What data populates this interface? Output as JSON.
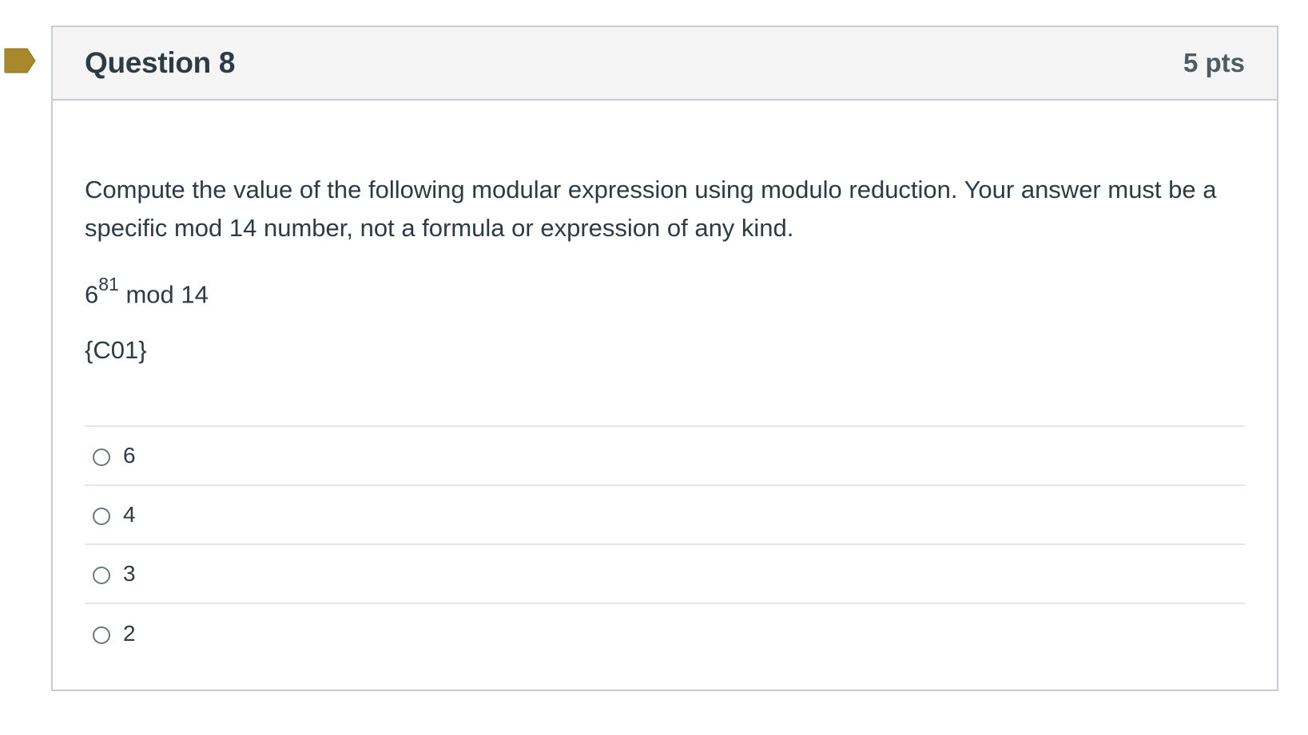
{
  "question": {
    "title": "Question 8",
    "points": "5 pts",
    "text": "Compute the value of the following modular expression using modulo reduction. Your answer must be a specific mod 14 number, not a formula or expression of any kind.",
    "expression": {
      "base": "6",
      "exponent": "81",
      "suffix": " mod 14"
    },
    "placeholder": "{C01}",
    "answers": [
      {
        "label": "6",
        "selected": false
      },
      {
        "label": "4",
        "selected": false
      },
      {
        "label": "3",
        "selected": false
      },
      {
        "label": "2",
        "selected": false
      }
    ]
  },
  "colors": {
    "bookmark": "#a8882b",
    "header_bg": "#f5f5f5",
    "border": "#c7cdd1",
    "text": "#2d3b45"
  },
  "icons": {
    "bookmark": "bookmark-flag-icon",
    "radio": "radio-button-icon"
  }
}
